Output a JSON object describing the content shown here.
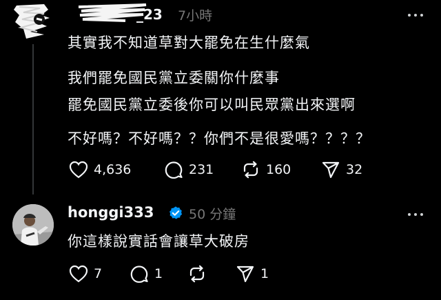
{
  "post": {
    "username_suffix": "_23",
    "time": "7小時",
    "lines": [
      "其實我不知道草對大罷免在生什麼氣",
      "我們罷免國民黨立委關你什麼事",
      "罷免國民黨立委後你可以叫民眾黨出來選啊",
      "不好嗎？不好嗎？？你們不是很愛嗎？？？？"
    ],
    "stats": {
      "likes": "4,636",
      "comments": "231",
      "reposts": "160",
      "shares": "32"
    }
  },
  "reply": {
    "username": "honggi333",
    "time": "50 分鐘",
    "text": "你這樣說實話會讓草大破房",
    "stats": {
      "likes": "7",
      "comments": "1",
      "shares": "1"
    }
  },
  "colors": {
    "background": "#000000",
    "text": "#f3f5f7",
    "muted": "#777777",
    "verified": "#0095f6"
  },
  "icons": [
    "heart-icon",
    "comment-icon",
    "repost-icon",
    "share-icon",
    "verified-badge-icon",
    "more-icon"
  ]
}
